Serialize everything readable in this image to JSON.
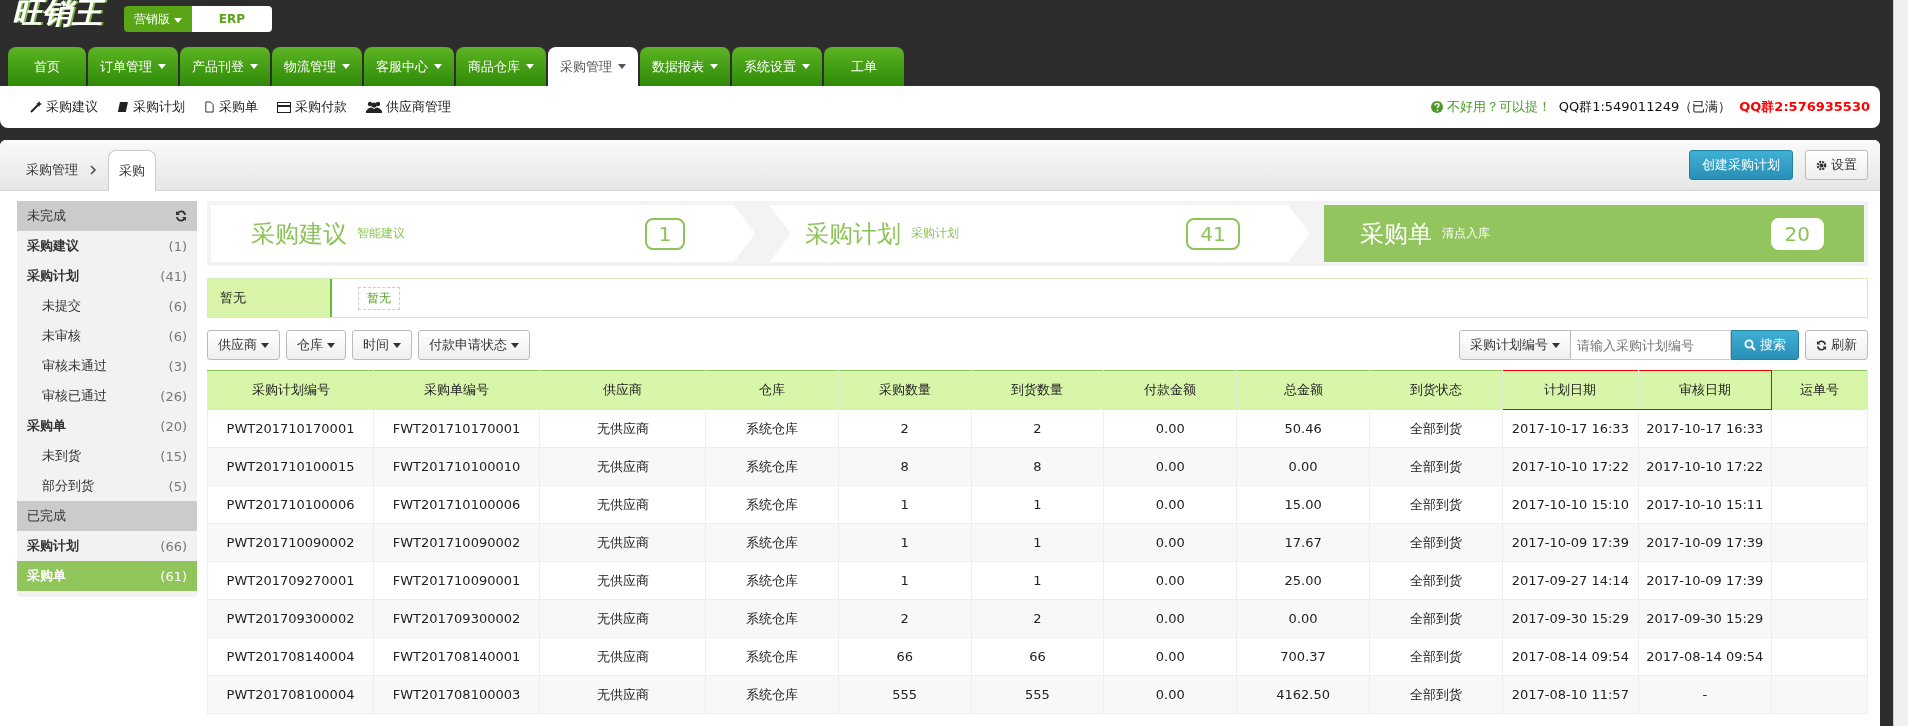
{
  "logo": {
    "text": "旺销王"
  },
  "edition": {
    "selector": "营销版",
    "product": "ERP"
  },
  "nav_tabs": [
    {
      "label": "首页",
      "dropdown": false,
      "selected": false
    },
    {
      "label": "订单管理",
      "dropdown": true,
      "selected": false
    },
    {
      "label": "产品刊登",
      "dropdown": true,
      "selected": false
    },
    {
      "label": "物流管理",
      "dropdown": true,
      "selected": false
    },
    {
      "label": "客服中心",
      "dropdown": true,
      "selected": false
    },
    {
      "label": "商品仓库",
      "dropdown": true,
      "selected": false
    },
    {
      "label": "采购管理",
      "dropdown": true,
      "selected": true
    },
    {
      "label": "数据报表",
      "dropdown": true,
      "selected": false
    },
    {
      "label": "系统设置",
      "dropdown": true,
      "selected": false
    },
    {
      "label": "工单",
      "dropdown": false,
      "selected": false
    }
  ],
  "sub_nav": [
    {
      "label": "采购建议",
      "kind": "wand"
    },
    {
      "label": "采购计划",
      "kind": "book"
    },
    {
      "label": "采购单",
      "kind": "file"
    },
    {
      "label": "采购付款",
      "kind": "card"
    },
    {
      "label": "供应商管理",
      "kind": "users"
    }
  ],
  "notice": {
    "feedback": "不好用？可以提！",
    "qq1": "QQ群1:549011249（已满）",
    "qq2": "QQ群2:576935530"
  },
  "breadcrumb": {
    "parent": "采购管理",
    "current": "采购"
  },
  "header_buttons": {
    "create": "创建采购计划",
    "settings": "设置"
  },
  "sidebar": [
    {
      "title": "未完成",
      "refresh": true,
      "items": [
        {
          "label": "采购建议",
          "count": "(1)",
          "selected": false
        },
        {
          "label": "采购计划",
          "count": "(41)",
          "selected": false,
          "children": [
            {
              "label": "未提交",
              "count": "(6)",
              "selected": false
            },
            {
              "label": "未审核",
              "count": "(6)",
              "selected": false
            },
            {
              "label": "审核未通过",
              "count": "(3)",
              "selected": false
            },
            {
              "label": "审核已通过",
              "count": "(26)",
              "selected": false
            }
          ]
        },
        {
          "label": "采购单",
          "count": "(20)",
          "selected": false,
          "children": [
            {
              "label": "未到货",
              "count": "(15)",
              "selected": false
            },
            {
              "label": "部分到货",
              "count": "(5)",
              "selected": false
            }
          ]
        }
      ]
    },
    {
      "title": "已完成",
      "refresh": false,
      "items": [
        {
          "label": "采购计划",
          "count": "(66)",
          "selected": false
        },
        {
          "label": "采购单",
          "count": "(61)",
          "selected": true
        }
      ]
    }
  ],
  "steps": [
    {
      "title": "采购建议",
      "subtitle": "智能建议",
      "count": "1",
      "selected": false
    },
    {
      "title": "采购计划",
      "subtitle": "采购计划",
      "count": "41",
      "selected": false
    },
    {
      "title": "采购单",
      "subtitle": "清点入库",
      "count": "20",
      "selected": true
    }
  ],
  "tag_filter": {
    "label": "暂无",
    "tag": "暂无"
  },
  "filters": [
    "供应商",
    "仓库",
    "时间",
    "付款申请状态"
  ],
  "search": {
    "field_select": "采购计划编号",
    "placeholder": "请输入采购计划编号",
    "button": "搜索",
    "refresh": "刷新"
  },
  "table": {
    "columns": [
      {
        "label": "采购计划编号",
        "highlighted": false
      },
      {
        "label": "采购单编号",
        "highlighted": false
      },
      {
        "label": "供应商",
        "highlighted": false
      },
      {
        "label": "仓库",
        "highlighted": false
      },
      {
        "label": "采购数量",
        "highlighted": false
      },
      {
        "label": "到货数量",
        "highlighted": false
      },
      {
        "label": "付款金额",
        "highlighted": false
      },
      {
        "label": "总金额",
        "highlighted": false
      },
      {
        "label": "到货状态",
        "highlighted": false
      },
      {
        "label": "计划日期",
        "highlighted": true
      },
      {
        "label": "审核日期",
        "highlighted": true
      },
      {
        "label": "运单号",
        "highlighted": false
      }
    ],
    "rows": [
      [
        "PWT201710170001",
        "FWT201710170001",
        "无供应商",
        "系统仓库",
        "2",
        "2",
        "0.00",
        "50.46",
        "全部到货",
        "2017-10-17 16:33",
        "2017-10-17 16:33",
        ""
      ],
      [
        "PWT201710100015",
        "FWT201710100010",
        "无供应商",
        "系统仓库",
        "8",
        "8",
        "0.00",
        "0.00",
        "全部到货",
        "2017-10-10 17:22",
        "2017-10-10 17:22",
        ""
      ],
      [
        "PWT201710100006",
        "FWT201710100006",
        "无供应商",
        "系统仓库",
        "1",
        "1",
        "0.00",
        "15.00",
        "全部到货",
        "2017-10-10 15:10",
        "2017-10-10 15:11",
        ""
      ],
      [
        "PWT201710090002",
        "FWT201710090002",
        "无供应商",
        "系统仓库",
        "1",
        "1",
        "0.00",
        "17.67",
        "全部到货",
        "2017-10-09 17:39",
        "2017-10-09 17:39",
        ""
      ],
      [
        "PWT201709270001",
        "FWT201710090001",
        "无供应商",
        "系统仓库",
        "1",
        "1",
        "0.00",
        "25.00",
        "全部到货",
        "2017-09-27 14:14",
        "2017-10-09 17:39",
        ""
      ],
      [
        "PWT201709300002",
        "FWT201709300002",
        "无供应商",
        "系统仓库",
        "2",
        "2",
        "0.00",
        "0.00",
        "全部到货",
        "2017-09-30 15:29",
        "2017-09-30 15:29",
        ""
      ],
      [
        "PWT201708140004",
        "FWT201708140001",
        "无供应商",
        "系统仓库",
        "66",
        "66",
        "0.00",
        "700.37",
        "全部到货",
        "2017-08-14 09:54",
        "2017-08-14 09:54",
        ""
      ],
      [
        "PWT201708100004",
        "FWT201708100003",
        "无供应商",
        "系统仓库",
        "555",
        "555",
        "0.00",
        "4162.50",
        "全部到货",
        "2017-08-10 11:57",
        "-",
        ""
      ]
    ]
  }
}
